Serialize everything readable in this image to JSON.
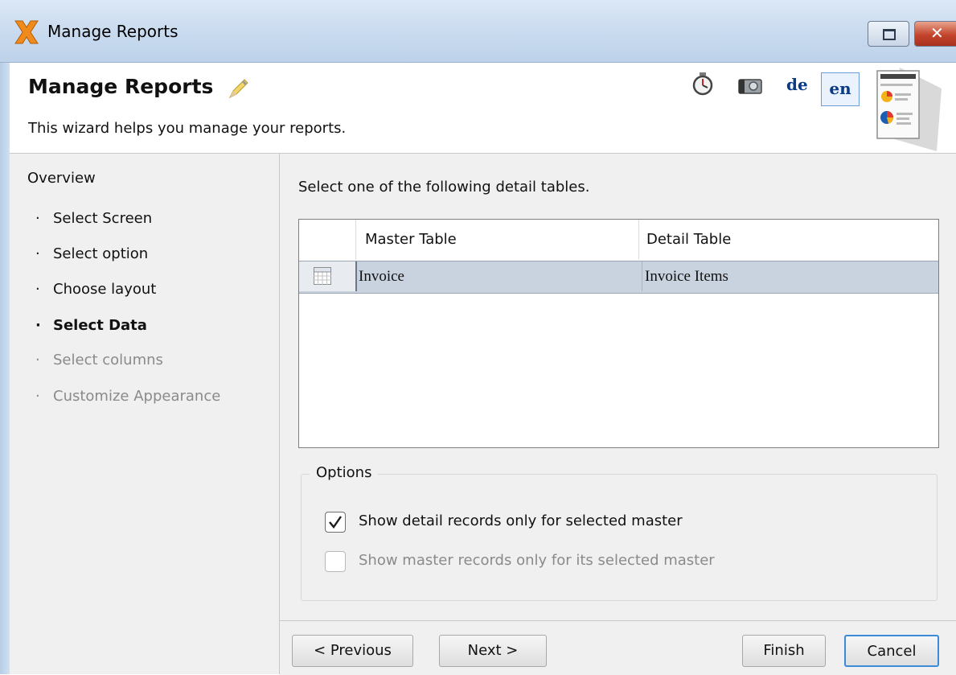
{
  "window": {
    "title": "Manage Reports",
    "controls": {
      "restore_icon": "restore-icon",
      "close_glyph": "✕"
    }
  },
  "header": {
    "title": "Manage Reports",
    "description": "This wizard helps you manage your reports.",
    "languages": [
      "de",
      "en"
    ],
    "selected_language": "en"
  },
  "sidebar": {
    "heading": "Overview",
    "bullet": "·",
    "items": [
      {
        "label": "Select Screen",
        "state": "done"
      },
      {
        "label": "Select option",
        "state": "done"
      },
      {
        "label": "Choose layout",
        "state": "done"
      },
      {
        "label": "Select Data",
        "state": "current"
      },
      {
        "label": "Select columns",
        "state": "disabled"
      },
      {
        "label": "Customize Appearance",
        "state": "disabled"
      }
    ]
  },
  "main": {
    "instruction": "Select one of the following detail tables.",
    "table": {
      "columns": [
        "Master Table",
        "Detail Table"
      ],
      "rows": [
        {
          "master": "Invoice",
          "detail": "Invoice Items",
          "selected": true
        }
      ]
    },
    "options": {
      "legend": "Options",
      "checkboxes": [
        {
          "label": "Show detail records only for selected master",
          "checked": true,
          "enabled": true
        },
        {
          "label": "Show master records only for its selected master",
          "checked": false,
          "enabled": false
        }
      ]
    }
  },
  "footer": {
    "previous": "< Previous",
    "next": "Next >",
    "finish": "Finish",
    "cancel": "Cancel"
  },
  "colors": {
    "titlebar": "#c7d9ee",
    "panel": "#f0f0f0",
    "selected_row": "#c9d3df",
    "language_link": "#0b3a8a",
    "focus_border": "#3b8bd9"
  }
}
